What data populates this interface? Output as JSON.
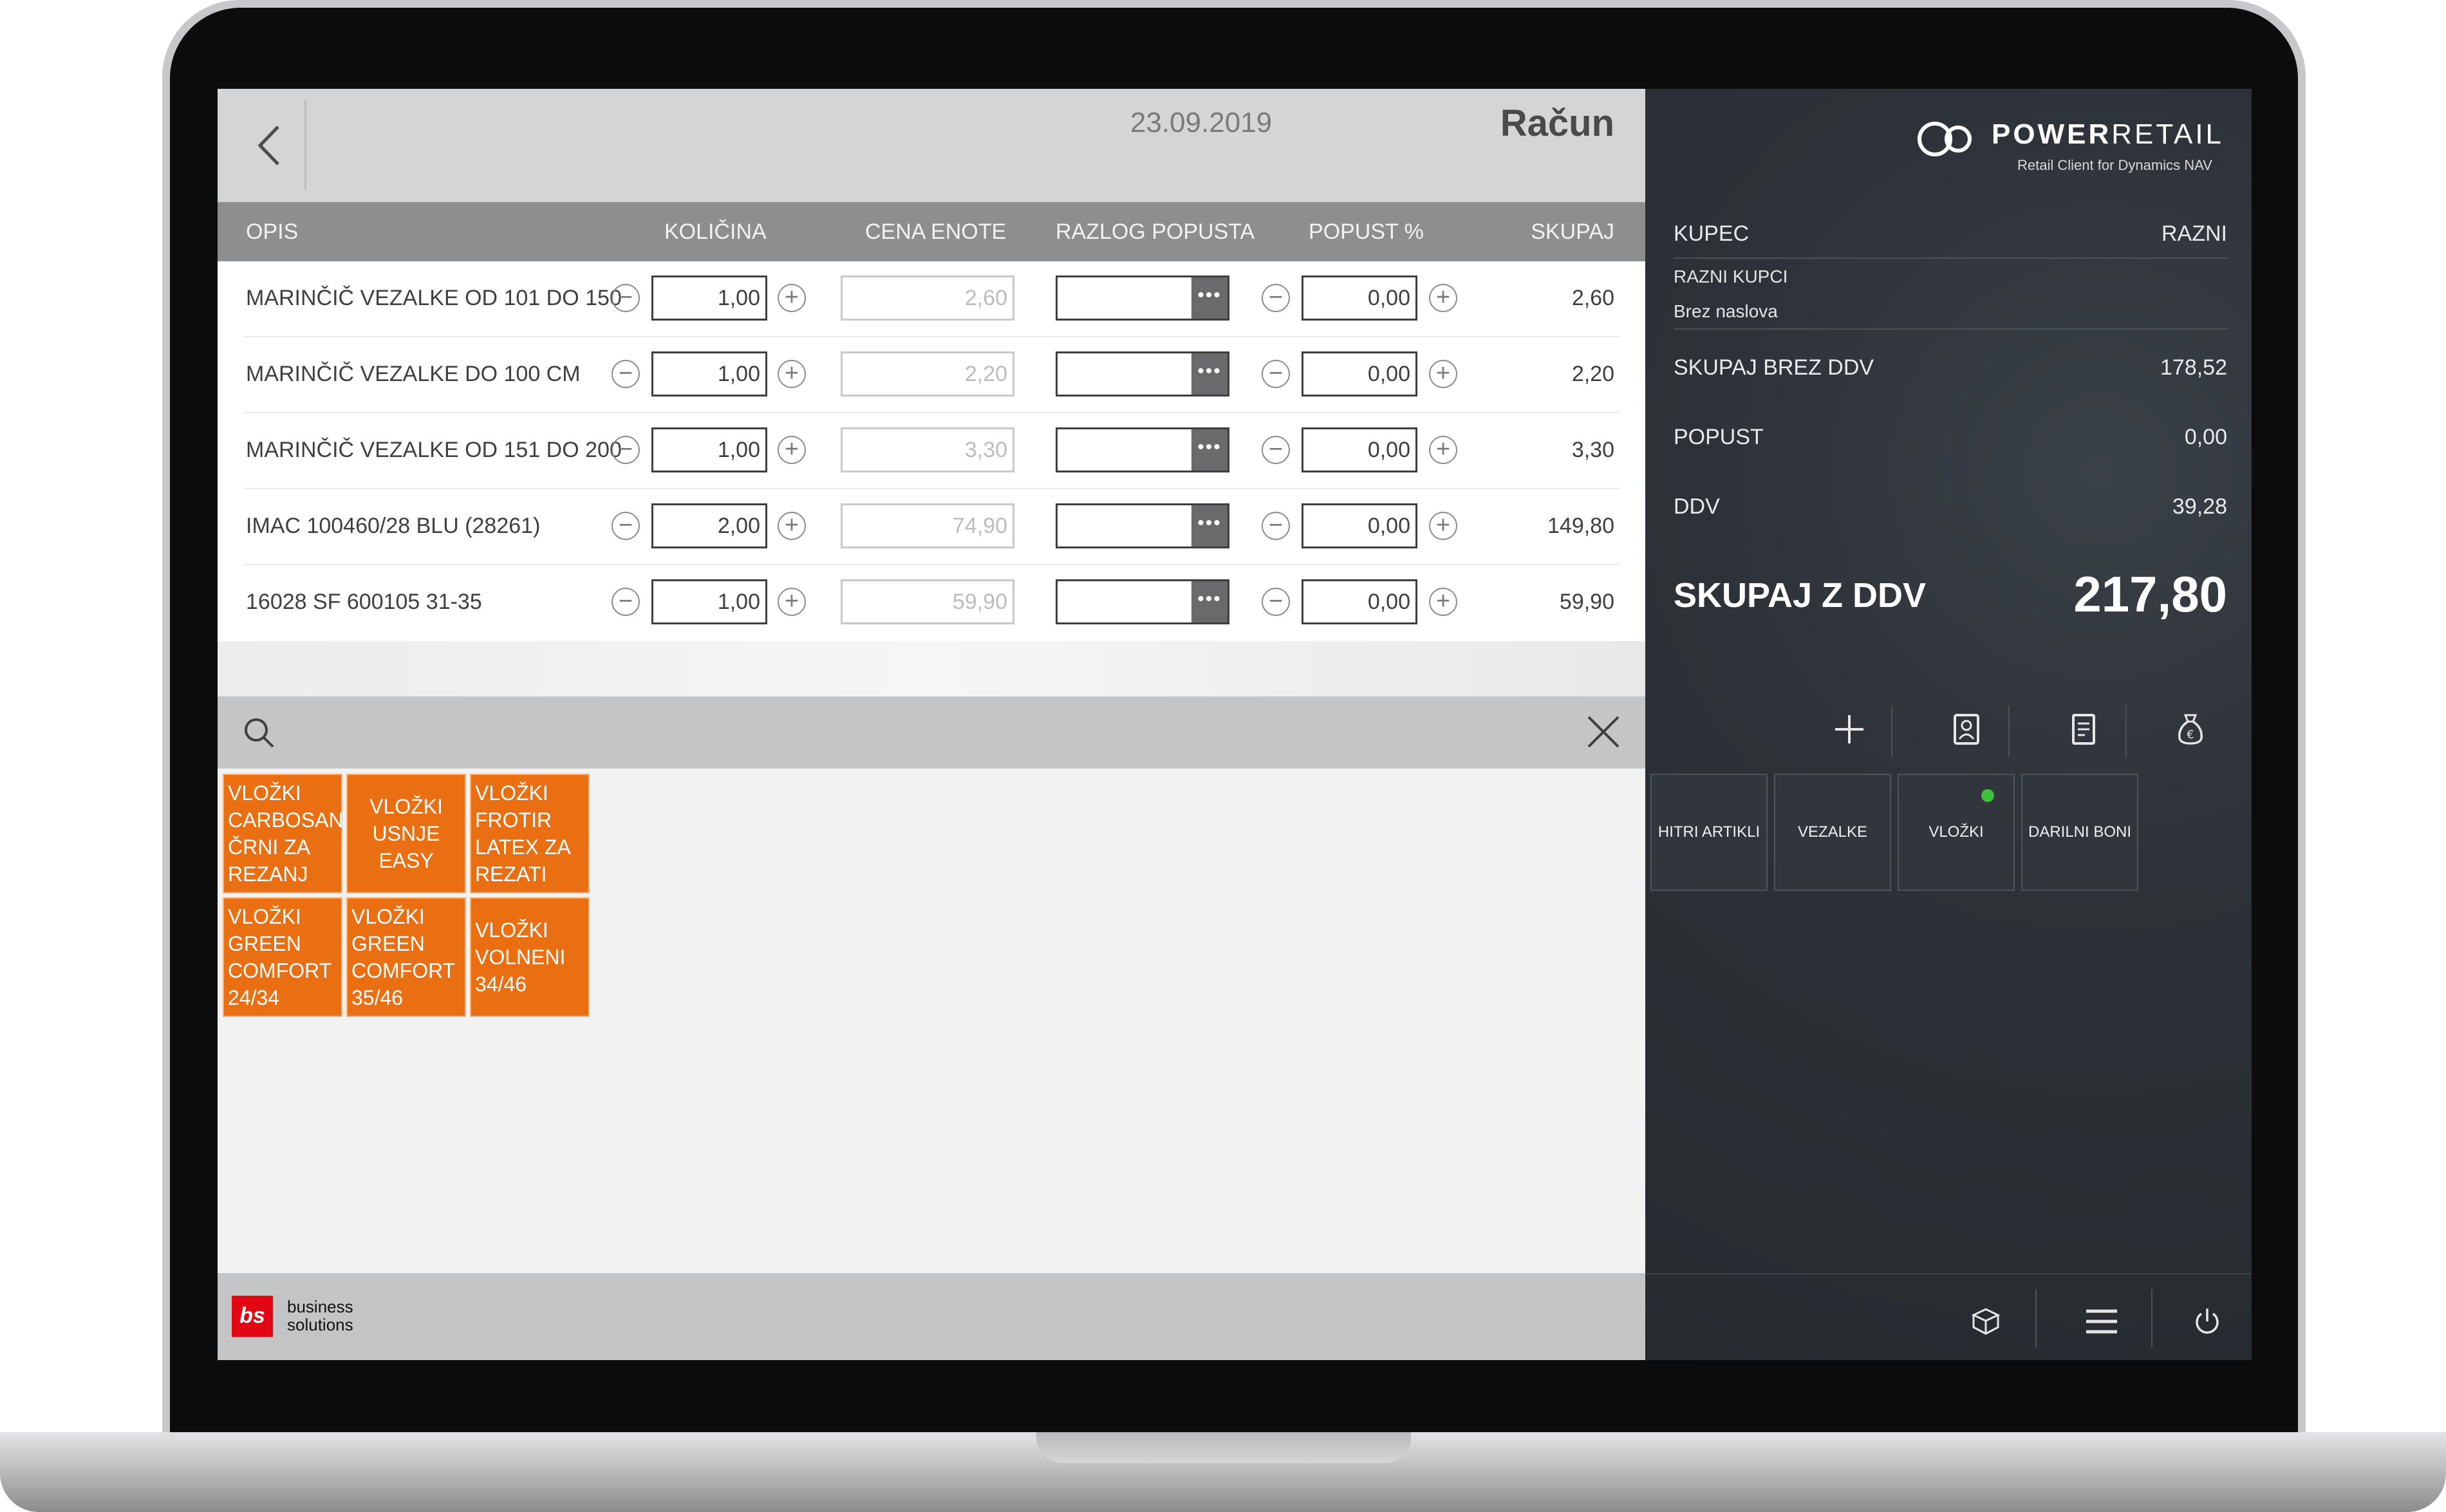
{
  "header": {
    "date": "23.09.2019",
    "title": "Račun"
  },
  "columns": {
    "desc": "OPIS",
    "qty": "KOLIČINA",
    "unit_price": "CENA ENOTE",
    "discount_reason": "RAZLOG POPUSTA",
    "discount_pct": "POPUST %",
    "total": "SKUPAJ"
  },
  "lines": [
    {
      "desc": "MARINČIČ VEZALKE OD 101 DO 150",
      "qty": "1,00",
      "price": "2,60",
      "discount": "0,00",
      "total": "2,60"
    },
    {
      "desc": "MARINČIČ VEZALKE DO 100 CM",
      "qty": "1,00",
      "price": "2,20",
      "discount": "0,00",
      "total": "2,20"
    },
    {
      "desc": "MARINČIČ VEZALKE OD 151 DO 200",
      "qty": "1,00",
      "price": "3,30",
      "discount": "0,00",
      "total": "3,30"
    },
    {
      "desc": "IMAC 100460/28 BLU (28261)",
      "qty": "2,00",
      "price": "74,90",
      "discount": "0,00",
      "total": "149,80"
    },
    {
      "desc": "16028  SF 600105  31-35",
      "qty": "1,00",
      "price": "59,90",
      "discount": "0,00",
      "total": "59,90"
    }
  ],
  "tiles": [
    {
      "lines": [
        "VLOŽKI",
        "CARBOSAN",
        "ČRNI ZA",
        "REZANJ"
      ]
    },
    {
      "lines": [
        "VLOŽKI",
        "USNJE",
        "EASY"
      ]
    },
    {
      "lines": [
        "VLOŽKI",
        "FROTIR",
        "LATEX ZA",
        "REZATI"
      ]
    },
    {
      "lines": [
        "VLOŽKI",
        "GREEN",
        "COMFORT",
        "24/34"
      ]
    },
    {
      "lines": [
        "VLOŽKI",
        "GREEN",
        "COMFORT",
        "35/46"
      ]
    },
    {
      "lines": [
        "VLOŽKI",
        "VOLNENI",
        "34/46"
      ]
    }
  ],
  "brand": {
    "name_bold": "POWER",
    "name_light": "RETAIL",
    "subtitle": "Retail Client for Dynamics NAV"
  },
  "footer": {
    "logo": "bs",
    "line1": "business",
    "line2": "solutions"
  },
  "summary": {
    "customer_label": "KUPEC",
    "customer_value": "RAZNI",
    "customer_name": "RAZNI KUPCI",
    "customer_address": "Brez naslova",
    "subtotal_label": "SKUPAJ BREZ DDV",
    "subtotal_value": "178,52",
    "discount_label": "POPUST",
    "discount_value": "0,00",
    "vat_label": "DDV",
    "vat_value": "39,28",
    "grand_label": "SKUPAJ Z DDV",
    "grand_value": "217,80"
  },
  "categories": [
    {
      "label": "HITRI ARTIKLI",
      "active": false
    },
    {
      "label": "VEZALKE",
      "active": false
    },
    {
      "label": "VLOŽKI",
      "active": true
    },
    {
      "label": "DARILNI BONI",
      "active": false
    }
  ],
  "icons": {
    "back": "chevron-left-icon",
    "search": "search-icon",
    "close": "close-icon",
    "add": "plus-icon",
    "customer": "contact-card-icon",
    "document": "document-icon",
    "payment": "money-bag-icon",
    "box": "package-icon",
    "menu": "hamburger-menu-icon",
    "power": "power-icon"
  },
  "colors": {
    "tile_orange": "#ea6e12",
    "active_dot": "#3fbf3a",
    "panel_dark": "#2c3237",
    "header_gray": "#8d8e90",
    "brand_red": "#e30613"
  }
}
